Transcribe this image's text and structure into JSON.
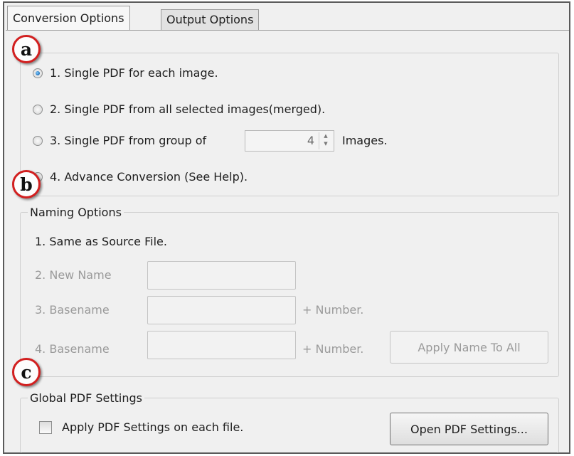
{
  "tabs": [
    {
      "label": "Conversion Options"
    },
    {
      "label": "Output Options"
    }
  ],
  "conversion": {
    "options": [
      {
        "label": "1. Single PDF for each image.",
        "checked": true
      },
      {
        "label": "2. Single PDF from all selected images(merged).",
        "checked": false
      },
      {
        "label": "3. Single PDF from group of",
        "checked": false
      },
      {
        "label": "4. Advance Conversion (See Help).",
        "checked": false
      }
    ],
    "group_count": "4",
    "group_suffix": "Images."
  },
  "naming": {
    "legend": "Naming Options",
    "same_as_source": "1. Same as Source File.",
    "new_name_label": "2. New Name",
    "basename3_label": "3. Basename",
    "basename4_label": "4. Basename",
    "plus_number": "+ Number.",
    "apply_name_button": "Apply Name To All"
  },
  "global": {
    "legend": "Global PDF Settings",
    "apply_checkbox_label": "Apply PDF Settings on each file.",
    "open_settings_button": "Open PDF Settings..."
  },
  "annotations": {
    "a": "a",
    "b": "b",
    "c": "c"
  },
  "colors": {
    "badge_border": "#d21f1f",
    "radio_selected": "#2a7bc4",
    "panel_bg": "#f0f0f0"
  }
}
